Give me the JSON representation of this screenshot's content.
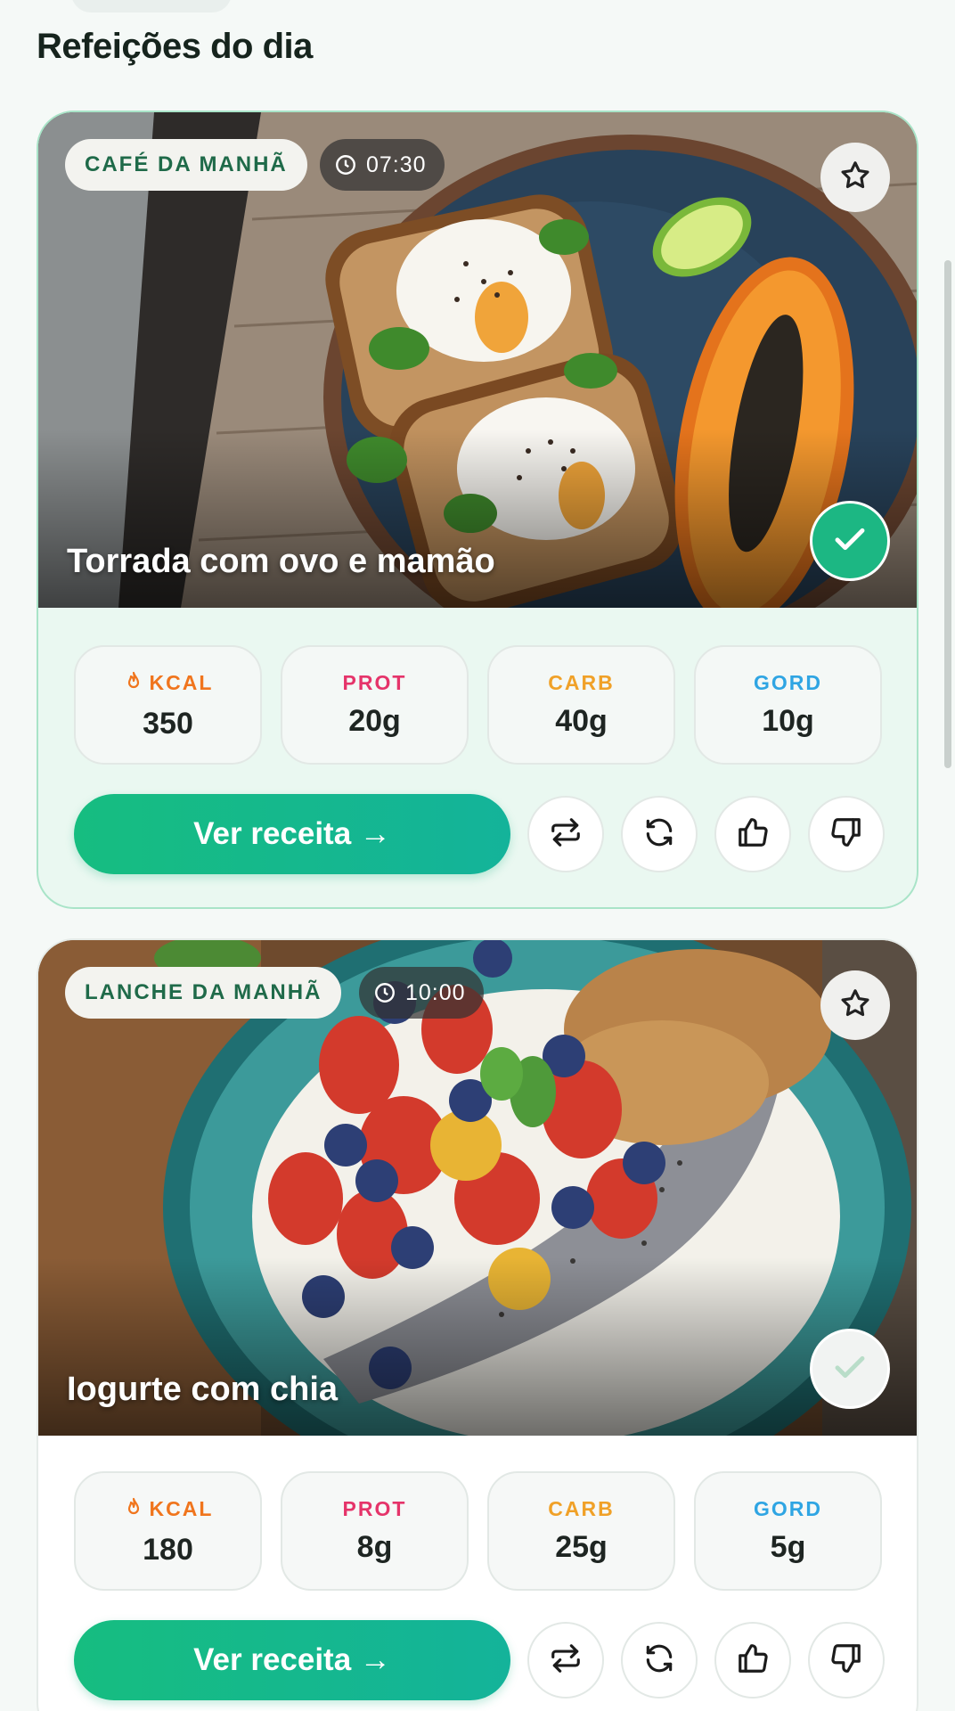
{
  "section": {
    "title": "Refeições do dia"
  },
  "icons": {
    "favorite": "star-icon",
    "done": "check-icon",
    "time": "clock-icon",
    "kcal": "flame-icon",
    "swap": "swap-icon",
    "regenerate": "refresh-icon",
    "like": "thumbs-up-icon",
    "dislike": "thumbs-down-icon"
  },
  "colors": {
    "accent": "#16bd80",
    "kcal": "#f0751d",
    "prot": "#e5346a",
    "carb": "#f0a128",
    "gord": "#2fa5e3"
  },
  "meals": [
    {
      "type": "CAFÉ DA MANHÃ",
      "time": "07:30",
      "name": "Torrada com ovo e mamão",
      "completed": true,
      "macros": [
        {
          "label": "KCAL",
          "value": "350"
        },
        {
          "label": "PROT",
          "value": "20g"
        },
        {
          "label": "CARB",
          "value": "40g"
        },
        {
          "label": "GORD",
          "value": "10g"
        }
      ],
      "recipe_button": "Ver receita →"
    },
    {
      "type": "LANCHE DA MANHÃ",
      "time": "10:00",
      "name": "Iogurte com chia",
      "completed": false,
      "macros": [
        {
          "label": "KCAL",
          "value": "180"
        },
        {
          "label": "PROT",
          "value": "8g"
        },
        {
          "label": "CARB",
          "value": "25g"
        },
        {
          "label": "GORD",
          "value": "5g"
        }
      ],
      "recipe_button": "Ver receita →"
    }
  ]
}
